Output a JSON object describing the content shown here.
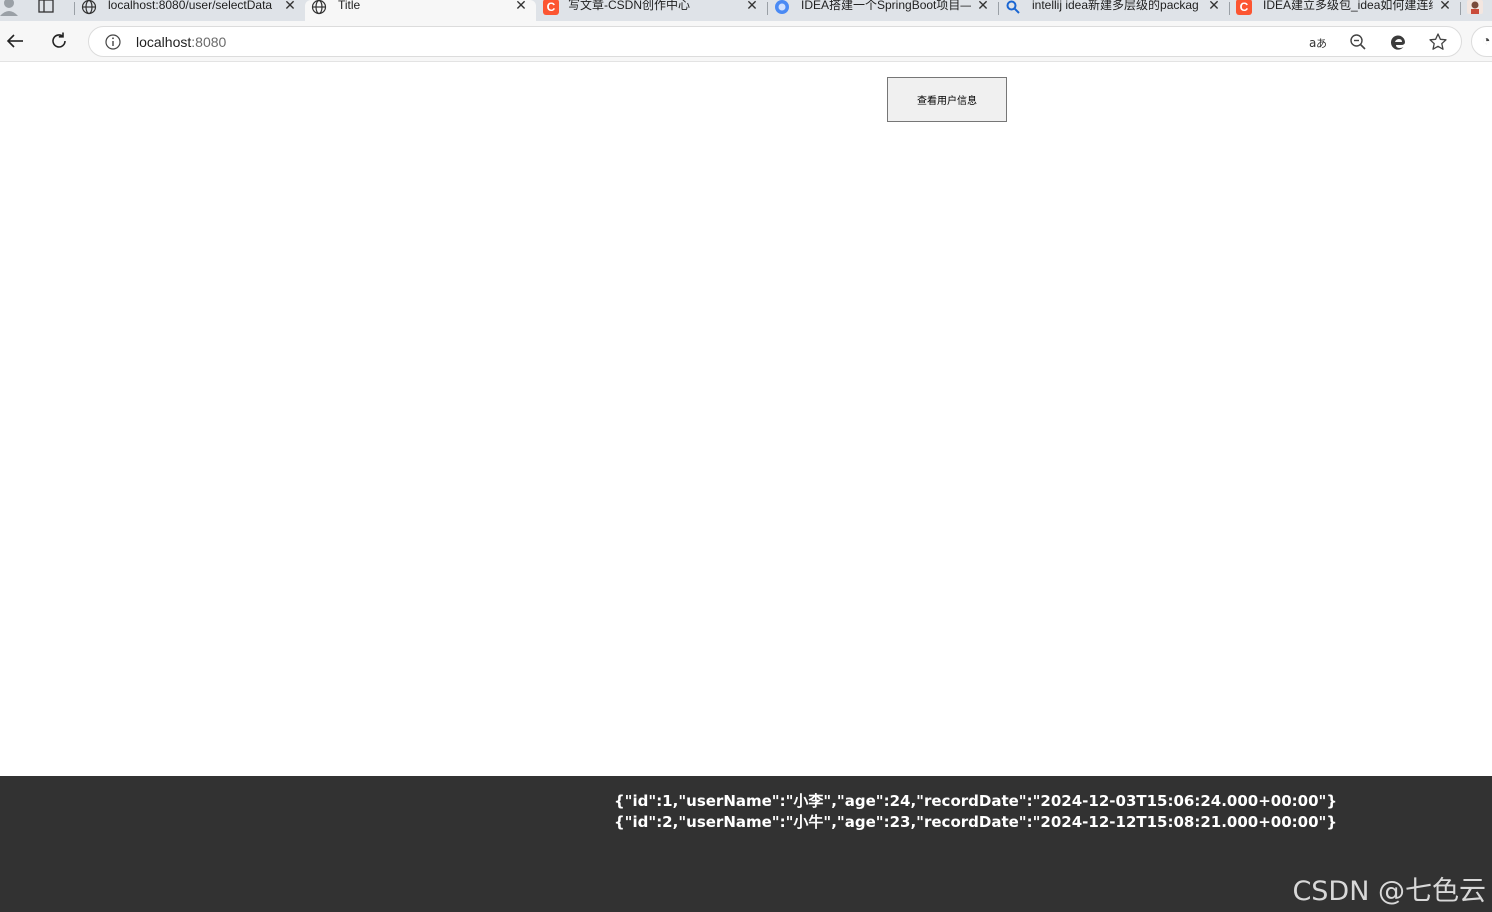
{
  "browser": {
    "tabs": [
      {
        "label": "localhost:8080/user/selectData",
        "favicon": "globe-icon",
        "active": false
      },
      {
        "label": "Title",
        "favicon": "globe-icon",
        "active": true
      },
      {
        "label": "写文章-CSDN创作中心",
        "favicon": "csdn-icon",
        "active": false
      },
      {
        "label": "IDEA搭建一个SpringBoot项目—",
        "favicon": "blue-circle-icon",
        "active": false
      },
      {
        "label": "intellij idea新建多层级的packag",
        "favicon": "search-icon",
        "active": false
      },
      {
        "label": "IDEA建立多级包_idea如何建连续",
        "favicon": "csdn-icon",
        "active": false
      }
    ],
    "csdn_favicon_letter": "C",
    "address": {
      "host": "localhost",
      "port": ":8080"
    }
  },
  "page": {
    "button_label": "查看用户信息",
    "results": [
      "{\"id\":1,\"userName\":\"小李\",\"age\":24,\"recordDate\":\"2024-12-03T15:06:24.000+00:00\"}",
      "{\"id\":2,\"userName\":\"小牛\",\"age\":23,\"recordDate\":\"2024-12-12T15:08:21.000+00:00\"}"
    ]
  },
  "watermark": "CSDN @七色云",
  "colors": {
    "tabstrip_bg": "#dfe3e8",
    "toolbar_bg": "#f7f7f7",
    "result_panel_bg": "#323232",
    "csdn_brand": "#fc5531"
  }
}
